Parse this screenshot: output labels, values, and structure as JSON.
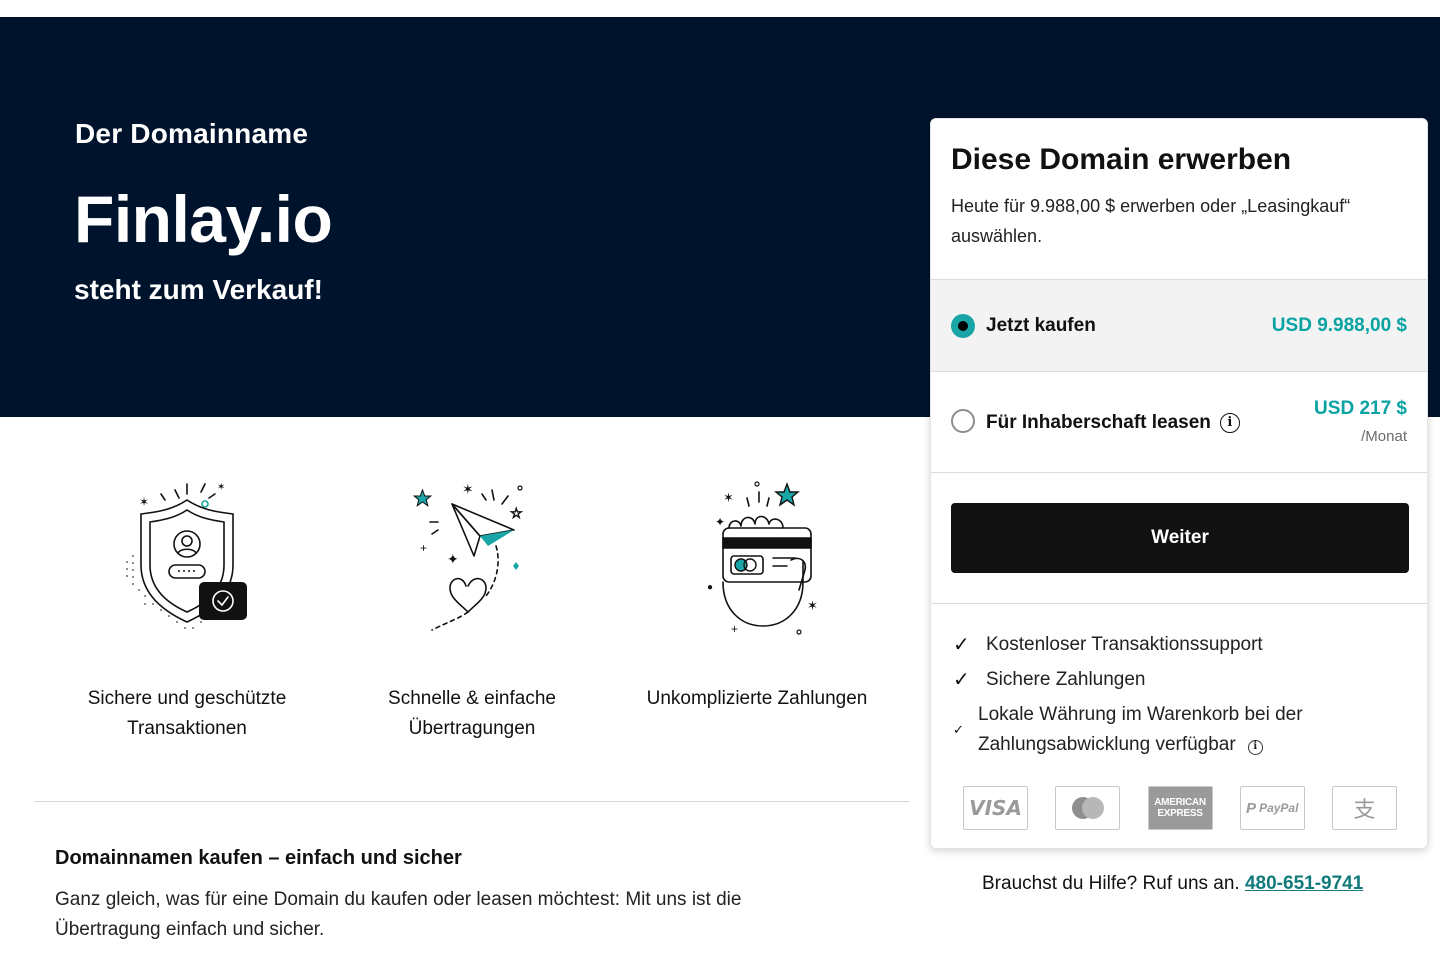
{
  "hero": {
    "label": "Der Domainname",
    "domain": "Finlay.io",
    "subtitle": "steht zum Verkauf!"
  },
  "features": [
    {
      "icon": "shield-user-check-icon",
      "label_line1": "Sichere und geschützte",
      "label_line2": "Transaktionen"
    },
    {
      "icon": "paper-plane-icon",
      "label_line1": "Schnelle & einfache",
      "label_line2": "Übertragungen"
    },
    {
      "icon": "hand-credit-card-icon",
      "label_line1": "Unkomplizierte Zahlungen",
      "label_line2": ""
    }
  ],
  "info": {
    "title": "Domainnamen kaufen – einfach und sicher",
    "text": "Ganz gleich, was für eine Domain du kaufen oder leasen möchtest: Mit uns ist die Übertragung einfach und sicher."
  },
  "card": {
    "title": "Diese Domain erwerben",
    "description": "Heute für 9.988,00 $ erwerben oder „Leasingkauf“ auswählen.",
    "options": [
      {
        "label": "Jetzt kaufen",
        "price": "USD 9.988,00 $",
        "selected": true
      },
      {
        "label": "Für Inhaberschaft leasen",
        "price": "USD 217 $",
        "period": "/Monat",
        "selected": false
      }
    ],
    "cta": "Weiter",
    "benefits": [
      "Kostenloser Transaktionssupport",
      "Sichere Zahlungen",
      "Lokale Währung im Warenkorb bei der Zahlungsabwicklung verfügbar"
    ],
    "payments": {
      "visa": "VISA",
      "mastercard": "mastercard-icon",
      "amex_line1": "AMERICAN",
      "amex_line2": "EXPRESS",
      "paypal": "PayPal",
      "alipay": "支"
    }
  },
  "help": {
    "text": "Brauchst du Hilfe? Ruf uns an.",
    "phone": "480-651-9741"
  },
  "colors": {
    "hero_bg": "#00132d",
    "accent_teal": "#0aa3a3",
    "cta_bg": "#111111",
    "link": "#127a7a"
  }
}
